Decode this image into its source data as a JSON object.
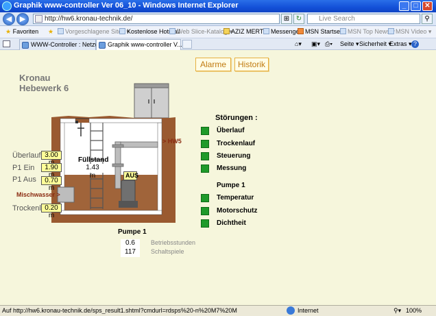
{
  "window": {
    "title": "Graphik www-controller Ver 06_10 - Windows Internet Explorer"
  },
  "address": {
    "url": "http://hw6.kronau-technik.de/",
    "search_placeholder": "Live Search"
  },
  "favorites": {
    "label": "Favoriten",
    "items": [
      {
        "label": "Vorgeschlagene Sites ▾",
        "enabled": false
      },
      {
        "label": "Kostenlose Hotmail",
        "enabled": true
      },
      {
        "label": "Web Slice-Katalog ▾",
        "enabled": false
      },
      {
        "label": "AZIZ MERT ▾",
        "enabled": true
      },
      {
        "label": "Messenger",
        "enabled": true
      },
      {
        "label": "MSN Startseite",
        "enabled": true
      },
      {
        "label": "MSN Top News ▾",
        "enabled": false
      },
      {
        "label": "MSN Video ▾",
        "enabled": false
      }
    ]
  },
  "tabs": [
    {
      "label": "WWW-Controller : Netzwerkf...",
      "active": false
    },
    {
      "label": "Graphik www-controller V...",
      "active": true
    }
  ],
  "toolbar": {
    "seite": "Seite ▾",
    "sicherheit": "Sicherheit ▾",
    "extras": "Extras ▾",
    "help": "?"
  },
  "page": {
    "buttons": {
      "alarme": "Alarme",
      "historik": "Historik"
    },
    "site_line1": "Kronau",
    "site_line2": "Hebewerk 6",
    "labels": {
      "ueberlauf": "Überlauf",
      "p1_ein": "P1 Ein",
      "p1_aus": "P1 Aus",
      "mischwasser": "Mischwasser >",
      "trockenl": "Trockenl.",
      "fuellstand": "Füllstand",
      "hw5": "> HW5",
      "aus": "AUS",
      "pumpe": "Pumpe 1",
      "betriebsstunden": "Betriebsstunden",
      "schaltspiele": "Schaltspiele"
    },
    "values": {
      "ueberlauf": "3.00 m",
      "p1_ein": "1.90 m",
      "p1_aus": "0.70 m",
      "trockenl": "0.20 m",
      "fuellstand": "1.43 m",
      "betriebsstunden": "0.6",
      "schaltspiele": "117"
    },
    "stoerungen": {
      "title": "Störungen :",
      "items": [
        "Überlauf",
        "Trockenlauf",
        "Steuerung",
        "Messung"
      ],
      "pump_title": "Pumpe 1",
      "pump_items": [
        "Temperatur",
        "Motorschutz",
        "Dichtheit"
      ],
      "led_color": "#1f9a2a"
    }
  },
  "status": {
    "url": "Auf http://hw6.kronau-technik.de/sps_result1.shtml?cmdurl=rdsps%20-n%20M7%20M",
    "zone": "Internet",
    "zoom": "100%"
  }
}
